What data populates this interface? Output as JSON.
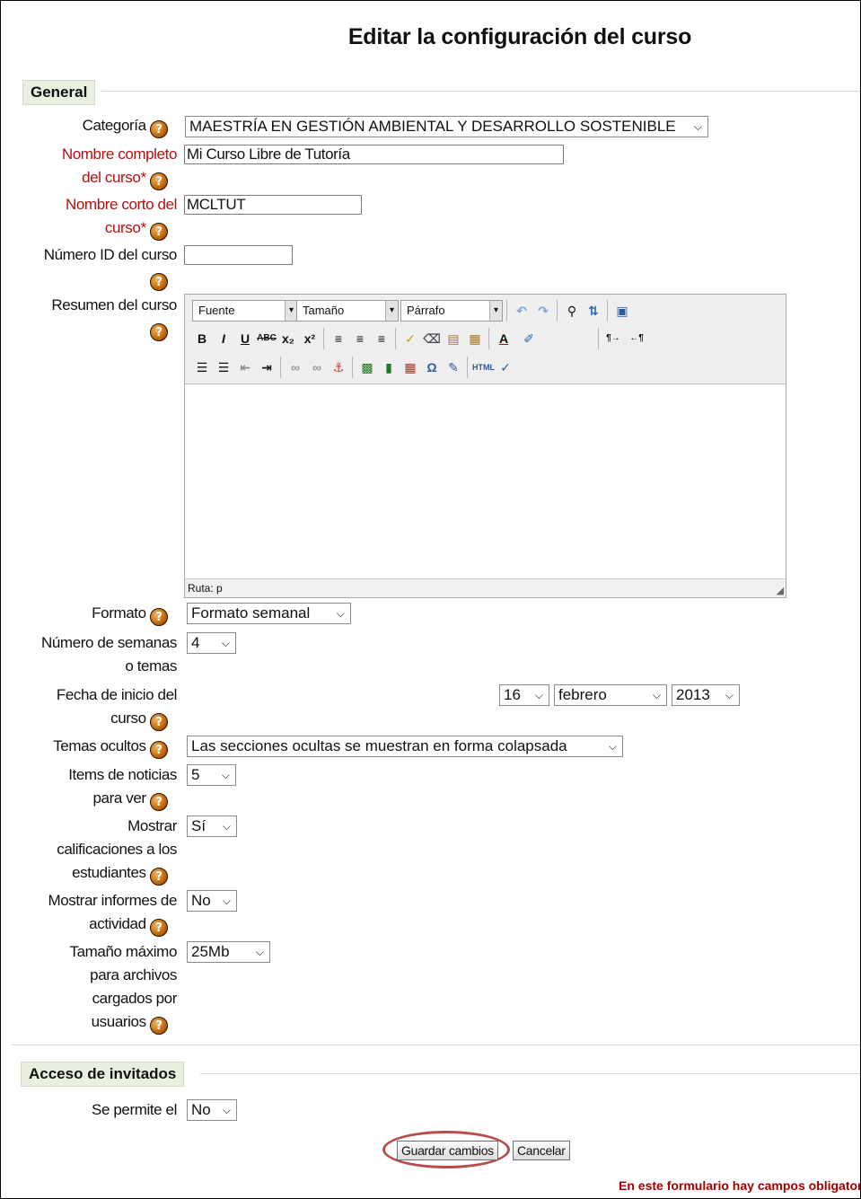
{
  "page_title": "Editar la configuración del curso",
  "sections": {
    "general": "General",
    "guest": "Acceso de invitados"
  },
  "fields": {
    "category": {
      "label": "Categoría",
      "value": "MAESTRÍA EN GESTIÓN AMBIENTAL Y DESARROLLO SOSTENIBLE"
    },
    "fullname": {
      "label_line1": "Nombre completo",
      "label_line2": "del curso*",
      "value": "Mi Curso Libre de Tutoría"
    },
    "shortname": {
      "label_line1": "Nombre corto del",
      "label_line2": "curso*",
      "value": "MCLTUT"
    },
    "idnumber": {
      "label": "Número ID del curso",
      "value": ""
    },
    "summary": {
      "label": "Resumen del curso",
      "path_label": "Ruta: p"
    },
    "format": {
      "label": "Formato",
      "value": "Formato semanal"
    },
    "numsections": {
      "label_line1": "Número de semanas",
      "label_line2": "o temas",
      "value": "4"
    },
    "startdate": {
      "label_line1": "Fecha de inicio del",
      "label_line2": "curso",
      "day": "16",
      "month": "febrero",
      "year": "2013"
    },
    "hiddensections": {
      "label": "Temas ocultos",
      "value": "Las secciones ocultas se muestran en forma colapsada"
    },
    "newsitems": {
      "label_line1": "Items de noticias",
      "label_line2": "para ver",
      "value": "5"
    },
    "showgrades": {
      "label_line1": "Mostrar",
      "label_line2": "calificaciones a los",
      "label_line3": "estudiantes",
      "value": "Sí"
    },
    "showreports": {
      "label_line1": "Mostrar informes de",
      "label_line2": "actividad",
      "value": "No"
    },
    "maxbytes": {
      "label_line1": "Tamaño máximo",
      "label_line2": "para archivos",
      "label_line3": "cargados por",
      "label_line4": "usuarios",
      "value": "25Mb"
    },
    "guest": {
      "label": "Se permite el",
      "value": "No"
    }
  },
  "editor": {
    "font_select": "Fuente",
    "size_select": "Tamaño",
    "paragraph_select": "Párrafo"
  },
  "buttons": {
    "save": "Guardar cambios",
    "cancel": "Cancelar"
  },
  "footnote": "En este formulario hay campos obligatorio",
  "colors": {
    "required_label": "#b40e0e",
    "legend_bg": "#e9f0df",
    "highlight_oval": "#b84b4b",
    "footnote": "#a50000"
  }
}
